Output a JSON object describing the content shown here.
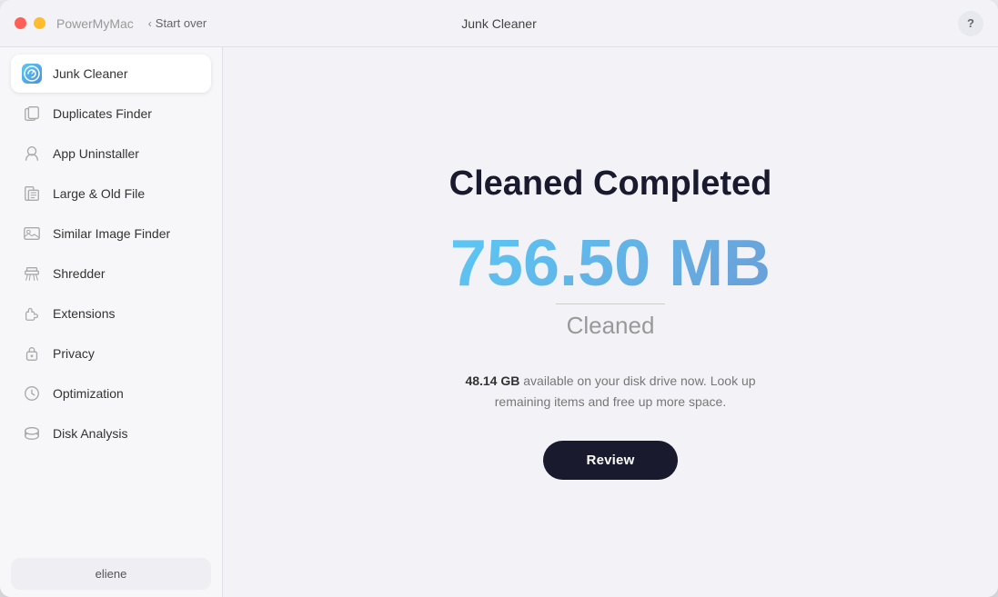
{
  "window": {
    "title": "Junk Cleaner",
    "app_name": "PowerMyMac"
  },
  "titlebar": {
    "start_over": "Start over",
    "help_label": "?"
  },
  "sidebar": {
    "items": [
      {
        "id": "junk-cleaner",
        "label": "Junk Cleaner",
        "active": true
      },
      {
        "id": "duplicates-finder",
        "label": "Duplicates Finder",
        "active": false
      },
      {
        "id": "app-uninstaller",
        "label": "App Uninstaller",
        "active": false
      },
      {
        "id": "large-old-file",
        "label": "Large & Old File",
        "active": false
      },
      {
        "id": "similar-image-finder",
        "label": "Similar Image Finder",
        "active": false
      },
      {
        "id": "shredder",
        "label": "Shredder",
        "active": false
      },
      {
        "id": "extensions",
        "label": "Extensions",
        "active": false
      },
      {
        "id": "privacy",
        "label": "Privacy",
        "active": false
      },
      {
        "id": "optimization",
        "label": "Optimization",
        "active": false
      },
      {
        "id": "disk-analysis",
        "label": "Disk Analysis",
        "active": false
      }
    ],
    "user": {
      "name": "eliene"
    }
  },
  "content": {
    "title": "Cleaned Completed",
    "amount": "756.50 MB",
    "amount_label": "Cleaned",
    "disk_info_bold": "48.14 GB",
    "disk_info_text": " available on your disk drive now. Look up remaining items and free up more space.",
    "review_button": "Review"
  }
}
